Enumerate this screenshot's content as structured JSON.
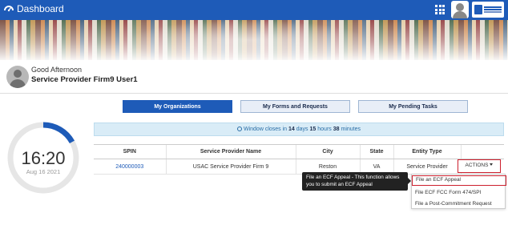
{
  "header": {
    "app_title": "Dashboard",
    "icons": [
      "dashboard-icon",
      "apps-grid-icon",
      "user-avatar-icon",
      "agency-logo"
    ],
    "brand_color": "#1e5bb8"
  },
  "greeting": {
    "salutation": "Good Afternoon",
    "user_name": "Service Provider Firm9 User1"
  },
  "tabs": [
    {
      "label": "My Organizations",
      "active": true
    },
    {
      "label": "My Forms and Requests",
      "active": false
    },
    {
      "label": "My Pending Tasks",
      "active": false
    }
  ],
  "clock": {
    "time": "16:20",
    "date": "Aug 16 2021",
    "progress_fraction": 0.17,
    "progress_color": "#1e5bb8"
  },
  "window_notice": {
    "prefix": "Window closes in",
    "days": "14",
    "days_unit": "days",
    "hours": "15",
    "hours_unit": "hours",
    "minutes": "38",
    "minutes_unit": "minutes"
  },
  "table": {
    "columns": [
      "SPIN",
      "Service Provider Name",
      "City",
      "State",
      "Entity Type",
      ""
    ],
    "rows": [
      {
        "spin": "240000003",
        "name": "USAC Service Provider Firm 9",
        "city": "Reston",
        "state": "VA",
        "entity_type": "Service Provider"
      }
    ]
  },
  "actions": {
    "label": "ACTIONS",
    "highlight_color": "#cc1f2d",
    "menu": [
      "File an ECF Appeal",
      "File ECF FCC Form 474/SPI",
      "File a Post-Commitment Request"
    ]
  },
  "tooltip": {
    "text": "File an ECF Appeal - This function allows you to submit an ECF Appeal"
  }
}
